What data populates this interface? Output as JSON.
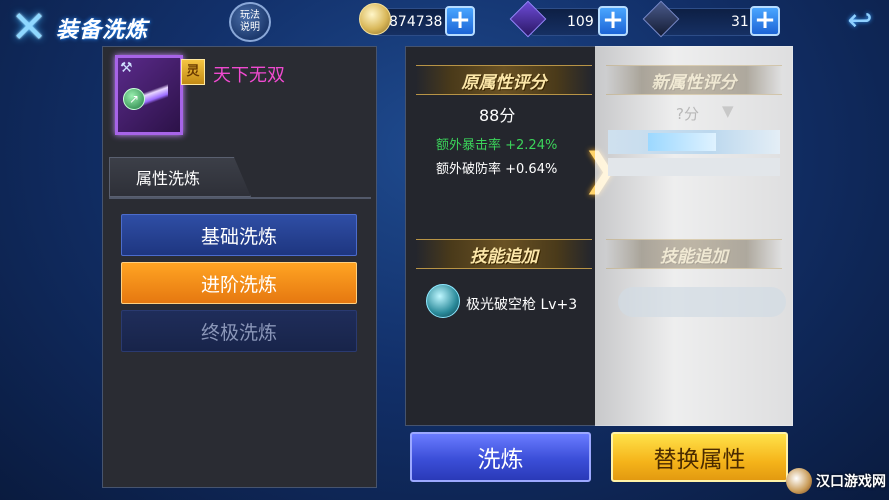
{
  "header": {
    "title": "装备洗炼",
    "help_line1": "玩法",
    "help_line2": "说明"
  },
  "resources": {
    "coins": "874738",
    "gems": "109",
    "crystals": "31"
  },
  "item": {
    "badge": "灵",
    "name": "天下无双"
  },
  "left": {
    "tab_label": "属性洗炼",
    "options": [
      "基础洗炼",
      "进阶洗炼",
      "终极洗炼"
    ],
    "selected": "进阶洗炼"
  },
  "original": {
    "header": "原属性评分",
    "score": "88分",
    "bonus_green": "额外暴击率 +2.24%",
    "bonus_white": "额外破防率 +0.64%",
    "skill_header": "技能追加",
    "skill_name": "极光破空枪 Lv+3"
  },
  "new": {
    "header": "新属性评分",
    "score": "?分",
    "skill_header": "技能追加"
  },
  "actions": {
    "refine": "洗炼",
    "replace": "替换属性"
  },
  "watermark": "汉口游戏网",
  "colors": {
    "accent_orange": "#ffa423",
    "item_name": "#f04ad0",
    "bonus_green": "#3bd35a",
    "gold_header": "#fbe6a8"
  }
}
